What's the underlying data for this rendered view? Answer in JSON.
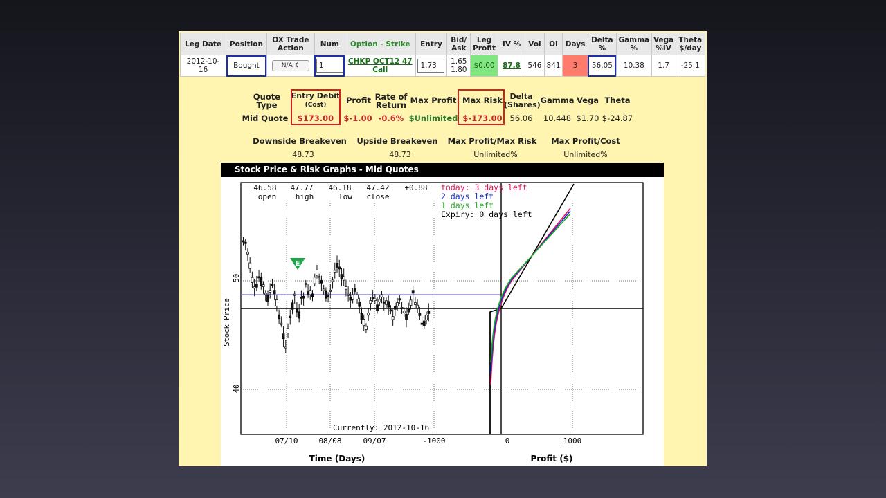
{
  "legs_table": {
    "headers": [
      "Leg Date",
      "Position",
      "OX Trade Action",
      "Num",
      "Option - Strike",
      "Entry",
      "Bid/ Ask",
      "Leg Profit",
      "IV %",
      "Vol",
      "OI",
      "Days",
      "Delta %",
      "Gamma %",
      "Vega %IV",
      "Theta $/day"
    ],
    "row": {
      "leg_date": "2012-10-16",
      "position": "Bought",
      "action": "N/A",
      "num": "1",
      "option": "CHKP OCT12 47 Call",
      "entry": "1.73",
      "bid": "1.65",
      "ask": "1.80",
      "leg_profit": "$0.00",
      "iv": "87.8",
      "vol": "546",
      "oi": "841",
      "days": "3",
      "delta": "56.05",
      "gamma": "10.38",
      "vega": "1.7",
      "theta": "-25.1"
    }
  },
  "summary": {
    "quote_type_label": "Quote Type",
    "entry_debit_label": "Entry Debit",
    "entry_debit_sub": "(Cost)",
    "profit_label": "Profit",
    "ror_label": "Rate of Return",
    "max_profit_label": "Max Profit",
    "max_risk_label": "Max Risk",
    "delta_label": "Delta (Shares)",
    "gamma_label": "Gamma",
    "vega_label": "Vega",
    "theta_label": "Theta",
    "row_label": "Mid Quote",
    "entry_debit": "$173.00",
    "profit": "$-1.00",
    "ror": "-0.6%",
    "max_profit": "$Unlimited",
    "max_risk": "$-173.00",
    "delta": "56.06",
    "gamma": "10.448",
    "vega": "$1.70",
    "theta": "$-24.87"
  },
  "breakevens": {
    "downside_label": "Downside Breakeven",
    "upside_label": "Upside Breakeven",
    "mp_mr_label": "Max Profit/Max Risk",
    "mp_cost_label": "Max Profit/Cost",
    "downside": "48.73",
    "upside": "48.73",
    "mp_mr": "Unlimited%",
    "mp_cost": "Unlimited%"
  },
  "graph": {
    "title": "Stock Price & Risk Graphs  - Mid Quotes",
    "ohlc": {
      "open": "46.58",
      "open_label": "open",
      "high": "47.77",
      "high_label": "high",
      "low": "46.18",
      "low_label": "low",
      "close": "47.42",
      "close_label": "close",
      "change": "+0.88"
    },
    "legend": {
      "today": "today: 3 days left",
      "two": "2 days left",
      "one": "1 days left",
      "expiry": "Expiry: 0 days left"
    },
    "colors": {
      "today": "#e0105a",
      "two": "#1a2fc8",
      "one": "#22aa22",
      "expiry": "#000000",
      "price_line": "#7070e0"
    },
    "y_label": "Stock Price",
    "y_ticks": [
      "50",
      "40"
    ],
    "x_ticks_time": [
      "07/10",
      "08/08",
      "09/07",
      "-1000"
    ],
    "x_ticks_profit": [
      "0",
      "1000"
    ],
    "currently": "Currently: 2012-10-16",
    "x_label_time": "Time (Days)",
    "x_label_profit": "Profit ($)",
    "earnings_marker": "E"
  }
}
